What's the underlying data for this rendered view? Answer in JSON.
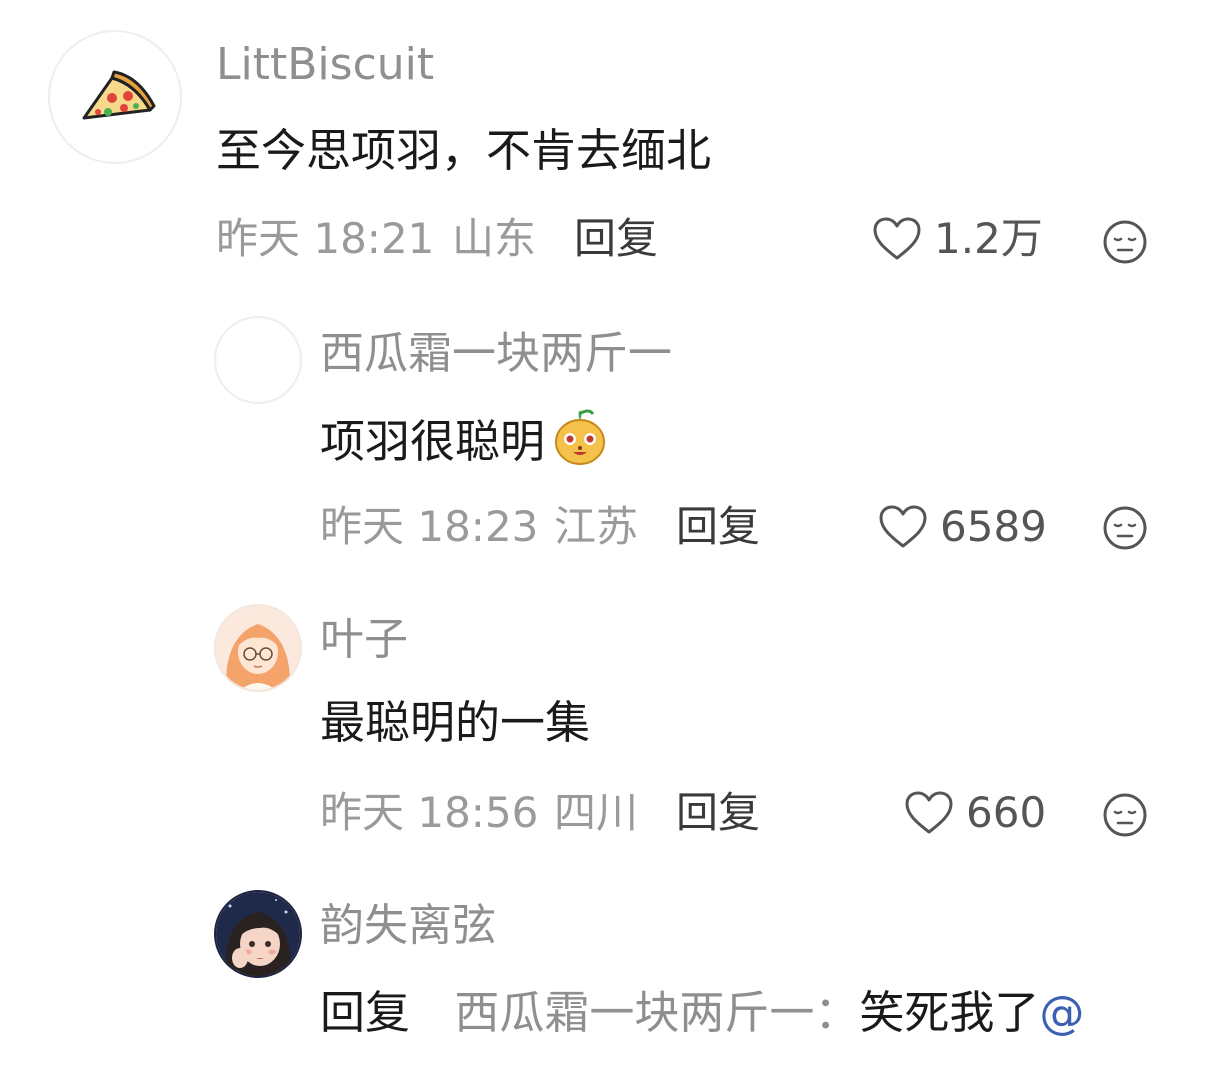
{
  "comments": [
    {
      "username": "LittBiscuit",
      "avatar": "pizza-slice",
      "text": "至今思项羽，不肯去缅北",
      "time": "昨天 18:21",
      "location": "山东",
      "reply_label": "回复",
      "likes": "1.2万"
    },
    {
      "username": "西瓜霜一块两斤一",
      "avatar": "blank",
      "text": "项羽很聪明",
      "emoji": "smug-face-emoji",
      "time": "昨天 18:23",
      "location": "江苏",
      "reply_label": "回复",
      "likes": "6589"
    },
    {
      "username": "叶子",
      "avatar": "orange-hair-girl",
      "text": "最聪明的一集",
      "time": "昨天 18:56",
      "location": "四川",
      "reply_label": "回复",
      "likes": "660"
    },
    {
      "username": "韵失离弦",
      "avatar": "illustrated-girl",
      "reply_prefix": "回复",
      "reply_target": "西瓜霜一块两斤一：",
      "text": "笑死我了",
      "at": "@"
    }
  ],
  "colors": {
    "username": "#8f8f8f",
    "text": "#1a1a1a",
    "meta": "#9a9a9a",
    "mention": "#3b5fb3"
  }
}
